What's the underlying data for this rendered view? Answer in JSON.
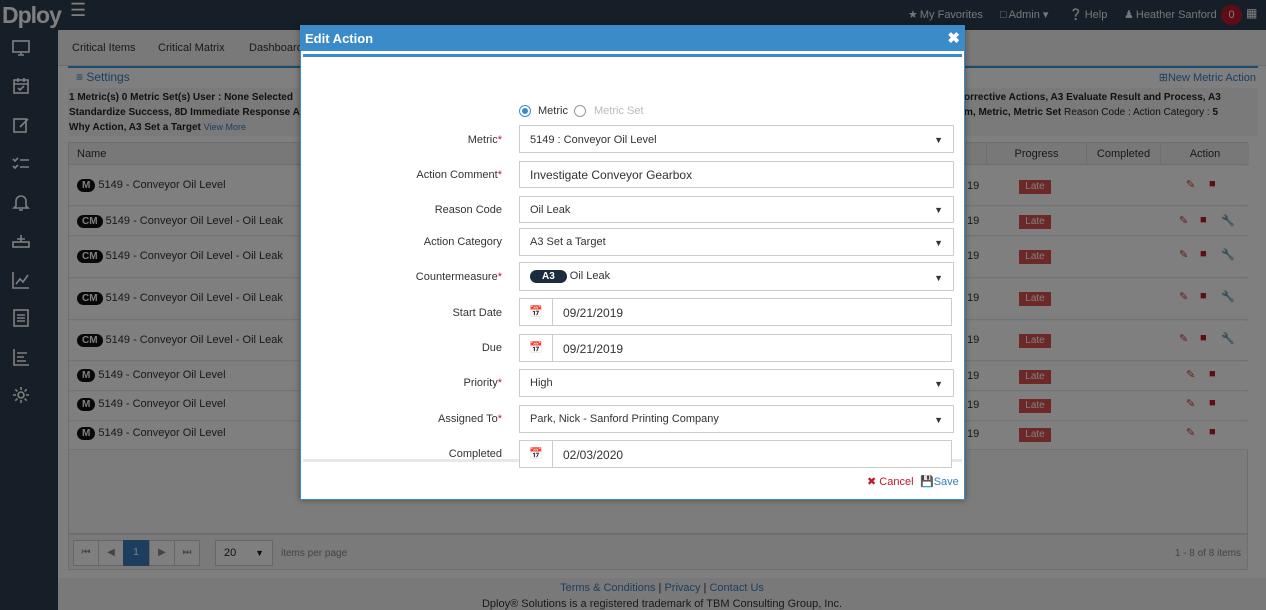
{
  "app": {
    "logo": "Dploy",
    "user_name": "Heather Sanford",
    "notifications_count": "0",
    "nav": {
      "favorites": "My Favorites",
      "admin": "Admin",
      "help": "Help"
    }
  },
  "sidebar_icons": [
    "monitor-icon",
    "calendar-check-icon",
    "edit-icon",
    "tasks-icon",
    "bell-icon",
    "network-icon",
    "line-chart-icon",
    "document-icon",
    "bar-list-icon",
    "gear-icon"
  ],
  "tabs": [
    "Critical Items",
    "Critical Matrix",
    "Dashboard"
  ],
  "settings_label": "Settings",
  "new_action_label": "New Metric Action",
  "filter_info": {
    "line1_prefix": "1 Metric(s) 0 Metric Set(s)   User : ",
    "line1_user": "None Selected",
    "line1_right": "orrective Actions, A3 Evaluate Result and Process, A3",
    "line2_left": "Standardize Success, 8D Immediate Response A",
    "line2_right_bold": "m, Metric, Metric Set",
    "line2_right_rest": "  Reason Code :   Action Category : ",
    "line2_count": "5",
    "line3": "Why Action, A3 Set a Target",
    "view_more": "View More"
  },
  "table": {
    "columns": {
      "name": "Name",
      "progress": "Progress",
      "completed": "Completed",
      "action": "Action"
    },
    "rows": [
      {
        "type": "M",
        "name": "5149 - Conveyor Oil Level",
        "idx": "19",
        "progress": "Late"
      },
      {
        "type": "CM",
        "name": "5149 - Conveyor Oil Level - Oil Leak",
        "idx": "19",
        "progress": "Late"
      },
      {
        "type": "CM",
        "name": "5149 - Conveyor Oil Level - Oil Leak",
        "idx": "19",
        "progress": "Late"
      },
      {
        "type": "CM",
        "name": "5149 - Conveyor Oil Level - Oil Leak",
        "idx": "19",
        "progress": "Late"
      },
      {
        "type": "CM",
        "name": "5149 - Conveyor Oil Level - Oil Leak",
        "idx": "19",
        "progress": "Late"
      },
      {
        "type": "M",
        "name": "5149 - Conveyor Oil Level",
        "idx": "19",
        "progress": "Late"
      },
      {
        "type": "M",
        "name": "5149 - Conveyor Oil Level",
        "idx": "19",
        "progress": "Late"
      },
      {
        "type": "M",
        "name": "5149 - Conveyor Oil Level",
        "idx": "19",
        "progress": "Late"
      }
    ]
  },
  "pager": {
    "current_page": "1",
    "per_page": "20",
    "per_page_label": "items per page",
    "item_count": "1 - 8 of 8 items"
  },
  "footer": {
    "terms": "Terms & Conditions",
    "privacy": "Privacy",
    "contact": "Contact Us",
    "copyright": "Dploy® Solutions is a registered trademark of TBM Consulting Group, Inc."
  },
  "modal": {
    "title": "Edit Action",
    "radio_metric": "Metric",
    "radio_metric_set": "Metric Set",
    "fields": {
      "metric": {
        "label": "Metric",
        "value": "5149 : Conveyor Oil Level"
      },
      "action_comment": {
        "label": "Action Comment",
        "value": "Investigate Conveyor Gearbox"
      },
      "reason_code": {
        "label": "Reason Code",
        "value": "Oil Leak"
      },
      "action_category": {
        "label": "Action Category",
        "value": "A3 Set a Target"
      },
      "countermeasure": {
        "label": "Countermeasure",
        "badge": "A3",
        "value": "Oil Leak"
      },
      "start_date": {
        "label": "Start Date",
        "value": "09/21/2019"
      },
      "due": {
        "label": "Due",
        "value": "09/21/2019"
      },
      "priority": {
        "label": "Priority",
        "value": "High"
      },
      "assigned_to": {
        "label": "Assigned To",
        "value": "Park, Nick - Sanford Printing Company"
      },
      "completed": {
        "label": "Completed",
        "value": "02/03/2020"
      }
    },
    "cancel_label": "Cancel",
    "save_label": "Save"
  }
}
